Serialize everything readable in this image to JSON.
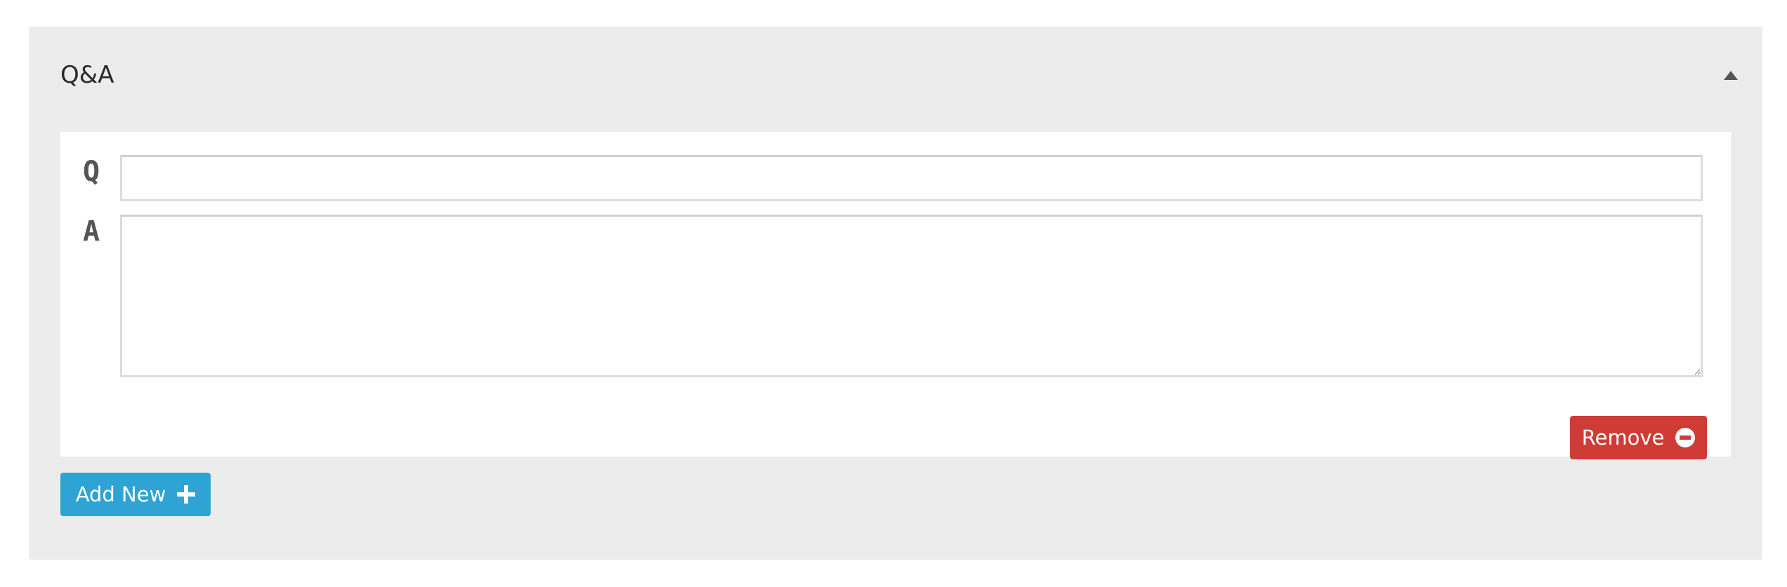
{
  "panel": {
    "title": "Q&A",
    "collapse_icon": "caret-up-icon"
  },
  "qa_item": {
    "question_label": "Q",
    "answer_label": "A",
    "question_value": "",
    "answer_value": "",
    "remove_label": "Remove",
    "remove_icon": "minus-circle-icon"
  },
  "actions": {
    "add_new_label": "Add New",
    "add_icon": "plus-icon"
  },
  "colors": {
    "panel_bg": "#edeced",
    "remove_button": "#cf3b35",
    "add_button": "#2ea3d4"
  }
}
